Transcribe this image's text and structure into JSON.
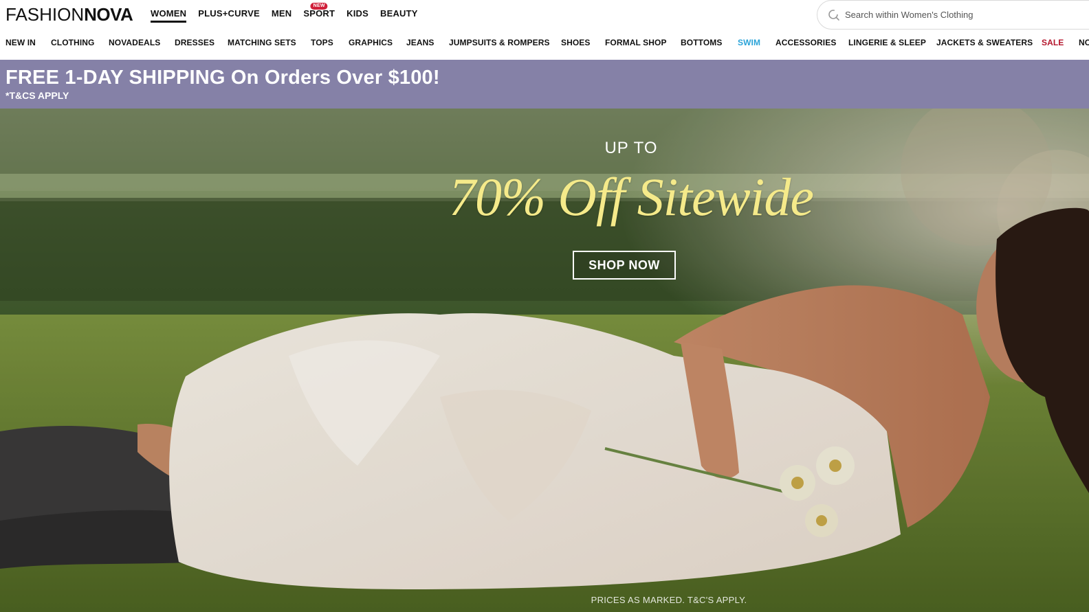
{
  "brand": {
    "logo_thin": "FASHION",
    "logo_bold": "NOVA"
  },
  "departments": [
    {
      "label": "WOMEN",
      "active": true
    },
    {
      "label": "PLUS+CURVE"
    },
    {
      "label": "MEN"
    },
    {
      "label": "SPORT",
      "badge": "NEW"
    },
    {
      "label": "KIDS"
    },
    {
      "label": "BEAUTY"
    }
  ],
  "search": {
    "placeholder": "Search within Women's Clothing",
    "icon": "search-icon"
  },
  "categories": [
    "NEW IN",
    "CLOTHING",
    "NOVADEALS",
    "DRESSES",
    "MATCHING SETS",
    "TOPS",
    "GRAPHICS",
    "JEANS",
    "JUMPSUITS & ROMPERS",
    "SHOES",
    "FORMAL SHOP",
    "BOTTOMS",
    "SWIM",
    "ACCESSORIES",
    "LINGERIE & SLEEP",
    "JACKETS & SWEATERS",
    "SALE",
    "NOVA"
  ],
  "colors": {
    "promo_bg": "#8581a7",
    "swim": "#2aa3d8",
    "sale": "#b4162c",
    "hero_headline": "#f5ea8a"
  },
  "promo": {
    "headline": "FREE 1-DAY SHIPPING On Orders Over $100!",
    "sub": "*T&CS APPLY"
  },
  "hero": {
    "upto": "UP TO",
    "headline": "70% Off Sitewide",
    "cta": "SHOP NOW",
    "disclaimer": "PRICES AS MARKED. T&C'S APPLY."
  }
}
